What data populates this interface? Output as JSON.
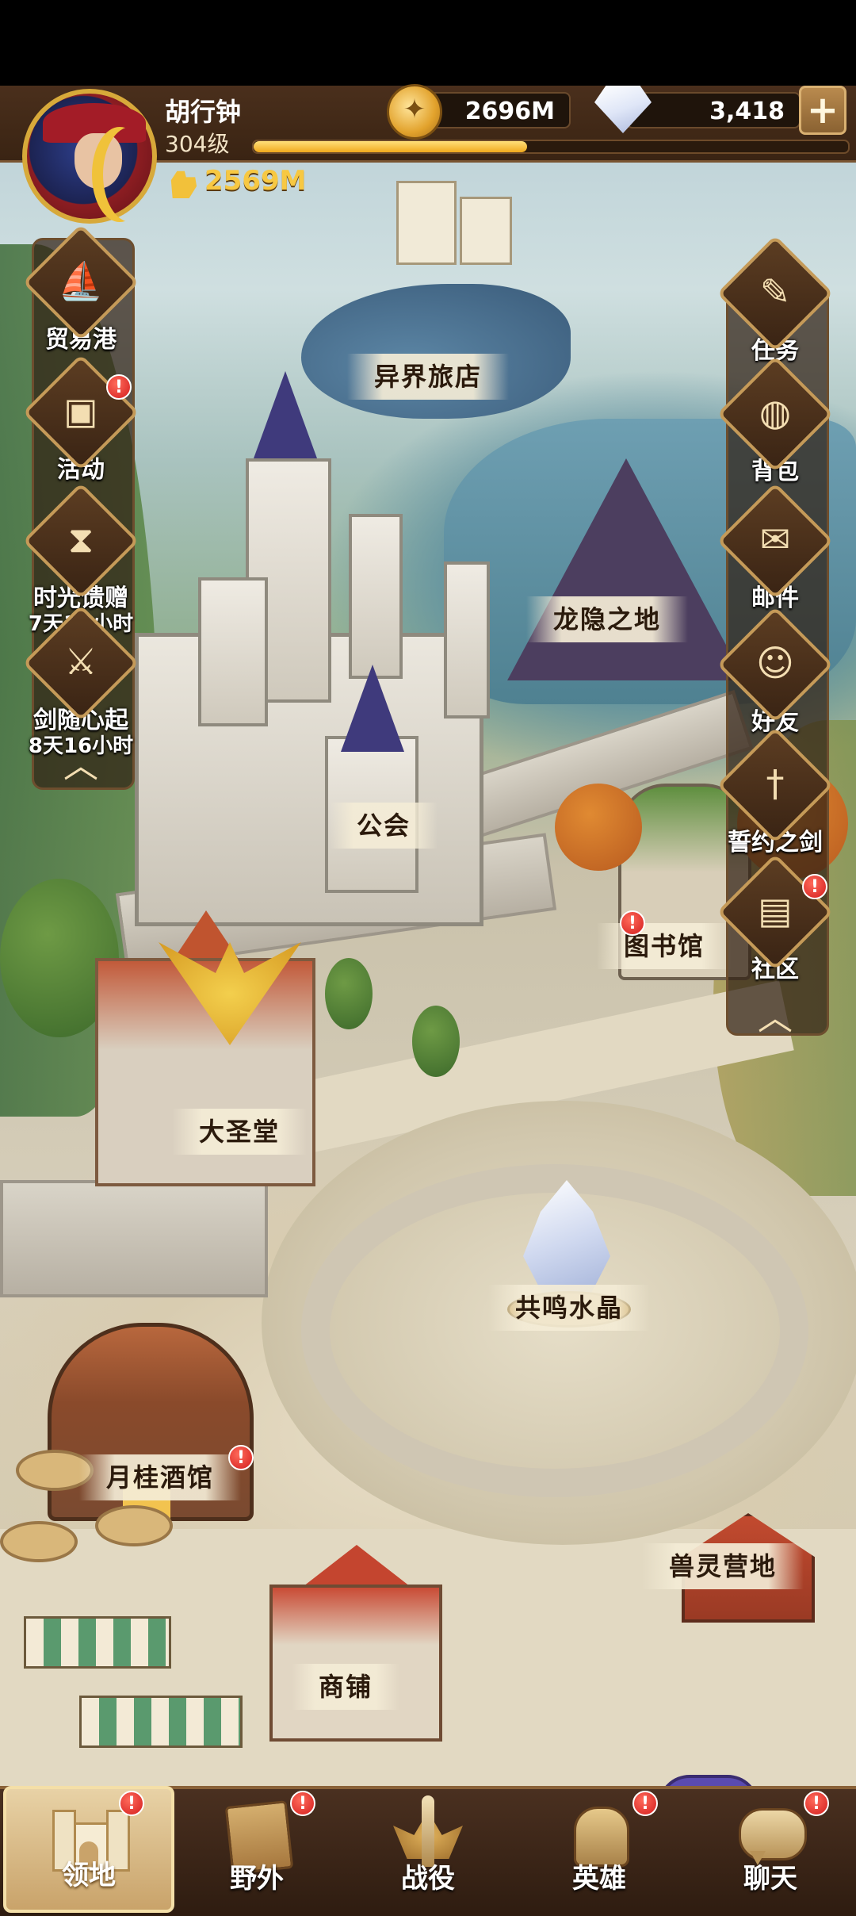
{
  "player": {
    "name": "胡行钟",
    "level": "304级",
    "power": "2569M",
    "xp_progress": 0.46
  },
  "resources": {
    "gold": "2696M",
    "diamonds": "3,418",
    "add_label": "+"
  },
  "buildings": {
    "inn": "异界旅店",
    "dragon_land": "龙隐之地",
    "guild": "公会",
    "library": "图书馆",
    "cathedral": "大圣堂",
    "crystal": "共鸣水晶",
    "tavern": "月桂酒馆",
    "beast_camp": "兽灵营地",
    "shop": "商铺"
  },
  "left_menu": [
    {
      "label": "贸易港",
      "icon": "ship-icon",
      "badge": false
    },
    {
      "label": "活动",
      "icon": "chest-icon",
      "badge": true
    },
    {
      "label": "时光馈赠",
      "timer": "7天16小时",
      "icon": "hourglass-icon",
      "badge": false
    },
    {
      "label": "剑随心起",
      "timer": "8天16小时",
      "icon": "sword-hero-icon",
      "badge": false
    }
  ],
  "right_menu": [
    {
      "label": "任务",
      "icon": "scroll-icon",
      "badge": false
    },
    {
      "label": "背包",
      "icon": "bag-icon",
      "badge": false
    },
    {
      "label": "邮件",
      "icon": "mail-icon",
      "badge": false
    },
    {
      "label": "好友",
      "icon": "friends-icon",
      "badge": false
    },
    {
      "label": "誓约之剑",
      "icon": "sword-icon",
      "badge": false
    },
    {
      "label": "社区",
      "icon": "map-scroll-icon",
      "badge": true
    }
  ],
  "bottom_nav": [
    {
      "label": "领地",
      "icon": "castle-icon",
      "active": true,
      "badge": true
    },
    {
      "label": "野外",
      "icon": "map-icon",
      "active": false,
      "badge": true
    },
    {
      "label": "战役",
      "icon": "battle-sword-icon",
      "active": false,
      "badge": false
    },
    {
      "label": "英雄",
      "icon": "helmet-icon",
      "active": false,
      "badge": true
    },
    {
      "label": "聊天",
      "icon": "chat-icon",
      "active": false,
      "badge": true
    }
  ],
  "badge_mark": "!",
  "collapse_glyph": "︿",
  "colors": {
    "header_bg": "#3a2413",
    "gold_text": "#f7c842",
    "badge_red": "#d31d1d",
    "label_bg": "#f4ecd6"
  }
}
